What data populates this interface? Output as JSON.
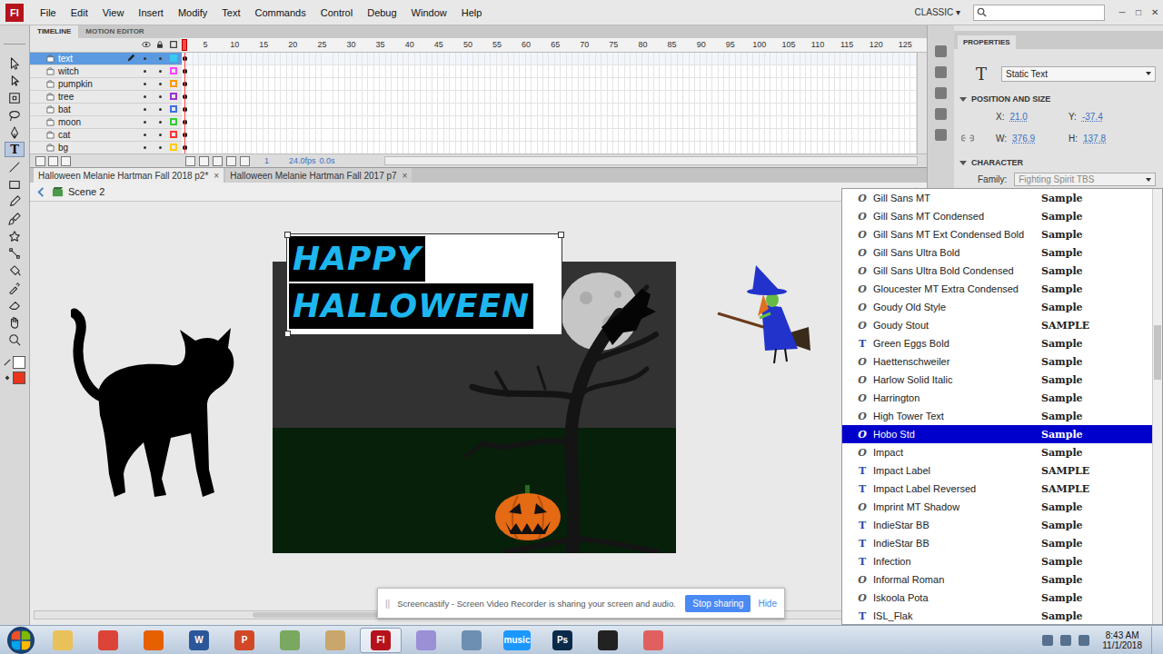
{
  "app": {
    "logo": "Fl",
    "menu": [
      "File",
      "Edit",
      "View",
      "Insert",
      "Modify",
      "Text",
      "Commands",
      "Control",
      "Debug",
      "Window",
      "Help"
    ],
    "workspace": "CLASSIC ▾",
    "window_controls": [
      "─",
      "□",
      "✕"
    ]
  },
  "tools": [
    {
      "kind": "selection",
      "selected": false,
      "glyph": ""
    },
    {
      "kind": "subselection",
      "selected": false,
      "glyph": ""
    },
    {
      "kind": "free-transform",
      "selected": false,
      "glyph": ""
    },
    {
      "kind": "lasso",
      "selected": false,
      "glyph": ""
    },
    {
      "kind": "pen",
      "selected": false,
      "glyph": ""
    },
    {
      "kind": "text",
      "selected": true,
      "glyph": "T"
    },
    {
      "kind": "line",
      "selected": false,
      "glyph": ""
    },
    {
      "kind": "rectangle",
      "selected": false,
      "glyph": ""
    },
    {
      "kind": "pencil",
      "selected": false,
      "glyph": ""
    },
    {
      "kind": "brush",
      "selected": false,
      "glyph": ""
    },
    {
      "kind": "deco",
      "selected": false,
      "glyph": ""
    },
    {
      "kind": "bone",
      "selected": false,
      "glyph": ""
    },
    {
      "kind": "paint-bucket",
      "selected": false,
      "glyph": ""
    },
    {
      "kind": "eyedropper",
      "selected": false,
      "glyph": ""
    },
    {
      "kind": "eraser",
      "selected": false,
      "glyph": ""
    },
    {
      "kind": "hand",
      "selected": false,
      "glyph": ""
    },
    {
      "kind": "zoom",
      "selected": false,
      "glyph": ""
    }
  ],
  "swatches": [
    {
      "kind": "stroke",
      "color": "#ffffff"
    },
    {
      "kind": "fill",
      "color": "#e8341c"
    }
  ],
  "timeline": {
    "tabs": [
      {
        "label": "TIMELINE",
        "selected": true
      },
      {
        "label": "MOTION EDITOR",
        "selected": false
      }
    ],
    "ruler": [
      "5",
      "10",
      "15",
      "20",
      "25",
      "30",
      "35",
      "40",
      "45",
      "50",
      "55",
      "60",
      "65",
      "70",
      "75",
      "80",
      "85",
      "90",
      "95",
      "100",
      "105",
      "110",
      "115",
      "120",
      "125"
    ],
    "layers": [
      {
        "name": "text",
        "selected": true,
        "editing": true,
        "color": "#38c8f0"
      },
      {
        "name": "witch",
        "selected": false,
        "editing": false,
        "color": "#ff44ff"
      },
      {
        "name": "pumpkin",
        "selected": false,
        "editing": false,
        "color": "#ff9900"
      },
      {
        "name": "tree",
        "selected": false,
        "editing": false,
        "color": "#9933cc"
      },
      {
        "name": "bat",
        "selected": false,
        "editing": false,
        "color": "#3d6fe8"
      },
      {
        "name": "moon",
        "selected": false,
        "editing": false,
        "color": "#33cc33"
      },
      {
        "name": "cat",
        "selected": false,
        "editing": false,
        "color": "#ff3333"
      },
      {
        "name": "bg",
        "selected": false,
        "editing": false,
        "color": "#ffcc00"
      }
    ],
    "status": {
      "frame": "1",
      "fps": "24.0fps",
      "time": "0.0s"
    }
  },
  "documents": [
    {
      "label": "Halloween Melanie Hartman Fall 2018 p2*",
      "selected": true,
      "close": "×"
    },
    {
      "label": "Halloween Melanie Hartman Fall 2017 p7",
      "selected": false,
      "close": "×"
    }
  ],
  "scene": {
    "label": "Scene 2"
  },
  "stage": {
    "text_lines": [
      "HAPPY",
      "HALLOWEEN"
    ],
    "text_selected": true
  },
  "properties": {
    "title": "PROPERTIES",
    "type_icon": "T",
    "text_type": "Static Text",
    "position_title": "POSITION AND SIZE",
    "fields": [
      {
        "label": "X:",
        "value": "21.0"
      },
      {
        "label": "Y:",
        "value": "-37.4"
      },
      {
        "label": "W:",
        "value": "376.9"
      },
      {
        "label": "H:",
        "value": "137.8"
      }
    ],
    "character_title": "CHARACTER",
    "family_label": "Family:",
    "family_value": "Fighting Spirit TBS"
  },
  "font_menu": {
    "items": [
      {
        "name": "Gill Sans MT",
        "sample": "Sample",
        "kind": "opentype",
        "icon": "O",
        "selected": false
      },
      {
        "name": "Gill Sans MT Condensed",
        "sample": "Sample",
        "kind": "opentype",
        "icon": "O",
        "selected": false
      },
      {
        "name": "Gill Sans MT Ext Condensed Bold",
        "sample": "Sample",
        "kind": "opentype",
        "icon": "O",
        "selected": false
      },
      {
        "name": "Gill Sans Ultra Bold",
        "sample": "Sample",
        "kind": "opentype",
        "icon": "O",
        "selected": false
      },
      {
        "name": "Gill Sans Ultra Bold Condensed",
        "sample": "Sample",
        "kind": "opentype",
        "icon": "O",
        "selected": false
      },
      {
        "name": "Gloucester MT Extra Condensed",
        "sample": "Sample",
        "kind": "opentype",
        "icon": "O",
        "selected": false
      },
      {
        "name": "Goudy Old Style",
        "sample": "Sample",
        "kind": "opentype",
        "icon": "O",
        "selected": false
      },
      {
        "name": "Goudy Stout",
        "sample": "SAMPLE",
        "kind": "opentype",
        "icon": "O",
        "selected": false
      },
      {
        "name": "Green Eggs Bold",
        "sample": "Sample",
        "kind": "truetype",
        "icon": "T",
        "selected": false
      },
      {
        "name": "Haettenschweiler",
        "sample": "Sample",
        "kind": "opentype",
        "icon": "O",
        "selected": false
      },
      {
        "name": "Harlow Solid Italic",
        "sample": "Sample",
        "kind": "opentype",
        "icon": "O",
        "selected": false
      },
      {
        "name": "Harrington",
        "sample": "Sample",
        "kind": "opentype",
        "icon": "O",
        "selected": false
      },
      {
        "name": "High Tower Text",
        "sample": "Sample",
        "kind": "opentype",
        "icon": "O",
        "selected": false
      },
      {
        "name": "Hobo Std",
        "sample": "Sample",
        "kind": "opentype",
        "icon": "O",
        "selected": true
      },
      {
        "name": "Impact",
        "sample": "Sample",
        "kind": "opentype",
        "icon": "O",
        "selected": false
      },
      {
        "name": "Impact Label",
        "sample": "SAMPLE",
        "kind": "truetype",
        "icon": "T",
        "selected": false
      },
      {
        "name": "Impact Label Reversed",
        "sample": "SAMPLE",
        "kind": "truetype",
        "icon": "T",
        "selected": false
      },
      {
        "name": "Imprint MT Shadow",
        "sample": "Sample",
        "kind": "opentype",
        "icon": "O",
        "selected": false
      },
      {
        "name": "IndieStar BB",
        "sample": "Sample",
        "kind": "truetype",
        "icon": "T",
        "selected": false
      },
      {
        "name": "IndieStar BB",
        "sample": "Sample",
        "kind": "truetype",
        "icon": "T",
        "selected": false
      },
      {
        "name": "Infection",
        "sample": "Sample",
        "kind": "truetype",
        "icon": "T",
        "selected": false
      },
      {
        "name": "Informal Roman",
        "sample": "Sample",
        "kind": "opentype",
        "icon": "O",
        "selected": false
      },
      {
        "name": "Iskoola Pota",
        "sample": "Sample",
        "kind": "opentype",
        "icon": "O",
        "selected": false
      },
      {
        "name": "ISL_Flak",
        "sample": "Sample",
        "kind": "truetype",
        "icon": "T",
        "selected": false
      }
    ]
  },
  "screencastify": {
    "handle": "||",
    "message": "Screencastify - Screen Video Recorder is sharing your screen and audio.",
    "stop": "Stop sharing",
    "hide": "Hide"
  },
  "taskbar": {
    "apps": [
      {
        "label": "",
        "color": "#e8c15a",
        "active": false
      },
      {
        "label": "",
        "color": "#db4437",
        "active": false
      },
      {
        "label": "",
        "color": "#e66000",
        "active": false
      },
      {
        "label": "W",
        "color": "#2b579a",
        "active": false
      },
      {
        "label": "P",
        "color": "#d24726",
        "active": false
      },
      {
        "label": "",
        "color": "#7aa860",
        "active": false
      },
      {
        "label": "",
        "color": "#c9a66b",
        "active": false
      },
      {
        "label": "Fl",
        "color": "#b5121b",
        "active": true
      },
      {
        "label": "",
        "color": "#9b8fd6",
        "active": false
      },
      {
        "label": "",
        "color": "#6d8fb0",
        "active": false
      },
      {
        "label": "music",
        "color": "#1a98ff",
        "active": false
      },
      {
        "label": "Ps",
        "color": "#0b2a4a",
        "active": false
      },
      {
        "label": "",
        "color": "#222222",
        "active": false
      },
      {
        "label": "",
        "color": "#e06060",
        "active": false
      }
    ],
    "time": "8:43 AM",
    "date": "11/1/2018"
  }
}
